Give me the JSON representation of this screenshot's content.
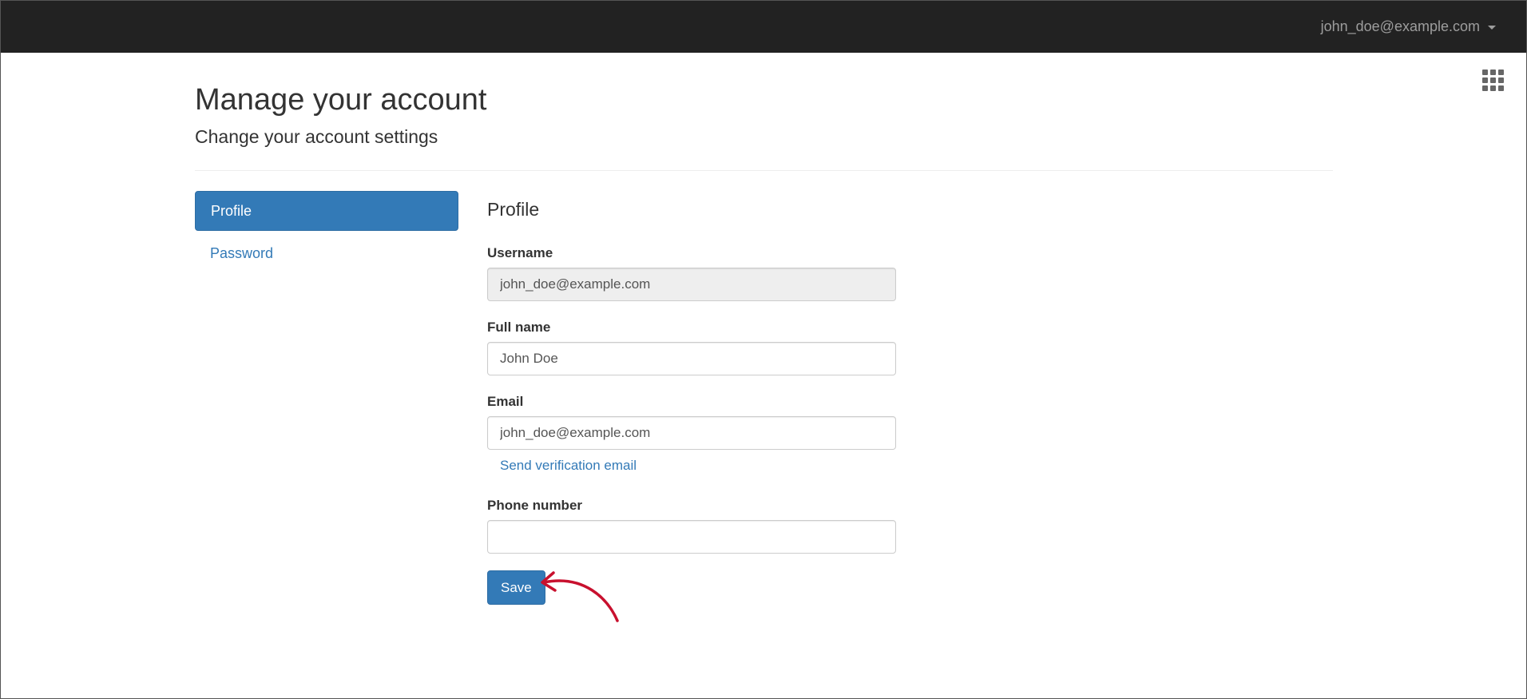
{
  "navbar": {
    "user_email": "john_doe@example.com",
    "caret_icon": "caret-down-icon"
  },
  "apps_menu": {
    "icon": "grid-apps-icon"
  },
  "header": {
    "title": "Manage your account",
    "subtitle": "Change your account settings"
  },
  "sidebar": {
    "items": [
      {
        "label": "Profile",
        "active": true
      },
      {
        "label": "Password",
        "active": false
      }
    ]
  },
  "profile": {
    "section_title": "Profile",
    "username": {
      "label": "Username",
      "value": "john_doe@example.com"
    },
    "full_name": {
      "label": "Full name",
      "value": "John Doe"
    },
    "email": {
      "label": "Email",
      "value": "john_doe@example.com",
      "verify_link": "Send verification email"
    },
    "phone": {
      "label": "Phone number",
      "value": ""
    },
    "save_label": "Save"
  },
  "colors": {
    "navbar_bg": "#222222",
    "primary": "#337ab7",
    "annotation": "#c8102e"
  }
}
